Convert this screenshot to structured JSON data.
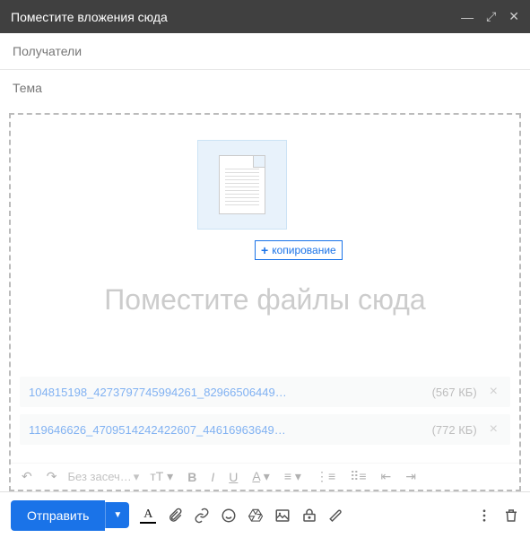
{
  "header": {
    "title": "Поместите вложения сюда"
  },
  "fields": {
    "recipients": "Получатели",
    "subject": "Тема"
  },
  "dropzone": {
    "copy_label": "копирование",
    "drop_text": "Поместите файлы сюда"
  },
  "attachments": [
    {
      "name": "104815198_4273797745994261_82966506449…",
      "size": "(567 КБ)"
    },
    {
      "name": "119646626_4709514242422607_44616963649…",
      "size": "(772 КБ)"
    }
  ],
  "format_toolbar": {
    "font_label": "Без засеч…"
  },
  "bottom": {
    "send": "Отправить"
  }
}
